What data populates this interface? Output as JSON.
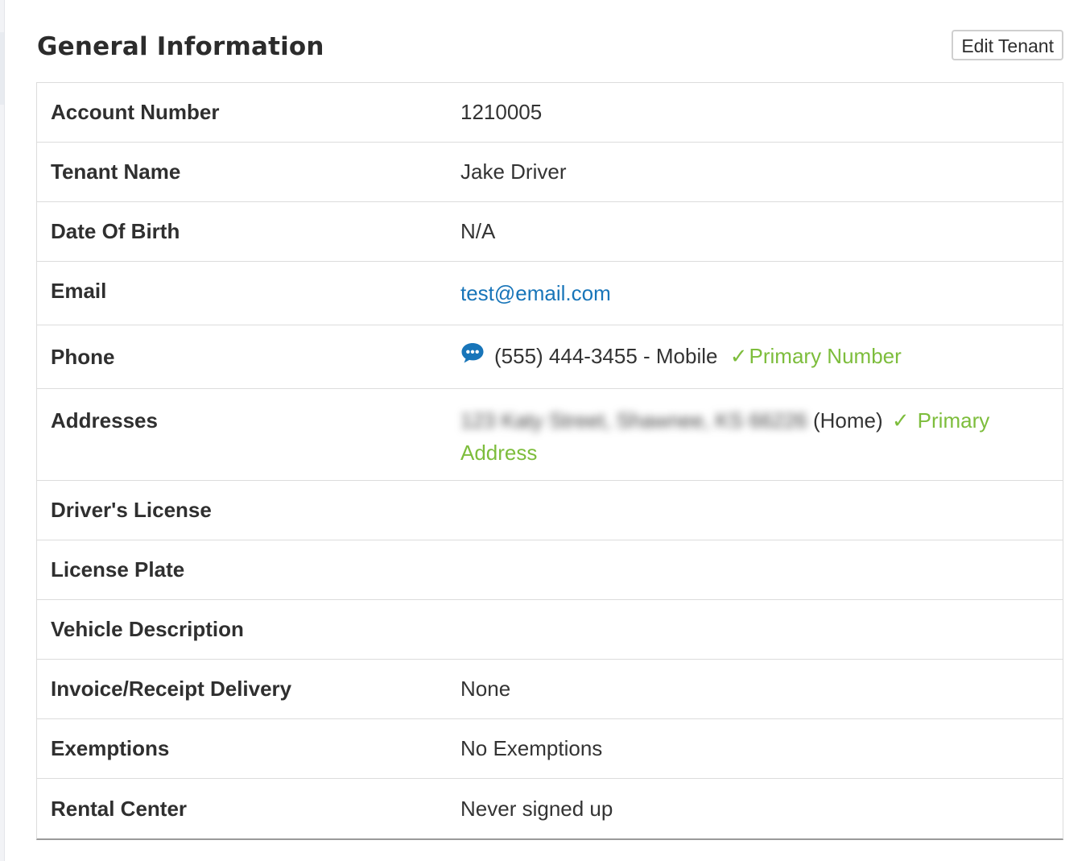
{
  "header": {
    "title": "General Information",
    "edit_button": "Edit Tenant"
  },
  "rows": [
    {
      "label": "Account Number",
      "value": "1210005"
    },
    {
      "label": "Tenant Name",
      "value": "Jake Driver"
    },
    {
      "label": "Date Of Birth",
      "value": "N/A"
    },
    {
      "label": "Email",
      "value": "test@email.com"
    },
    {
      "label": "Phone",
      "value": "(555) 444-3455 - Mobile",
      "badge": "Primary Number"
    },
    {
      "label": "Addresses",
      "value_blurred": "123 Katy Street, Shawnee, KS 66226",
      "value": " (Home) ",
      "badge": "Primary Address"
    },
    {
      "label": "Driver's License",
      "value": ""
    },
    {
      "label": "License Plate",
      "value": ""
    },
    {
      "label": "Vehicle Description",
      "value": ""
    },
    {
      "label": "Invoice/Receipt Delivery",
      "value": "None"
    },
    {
      "label": "Exemptions",
      "value": "No Exemptions"
    },
    {
      "label": "Rental Center",
      "value": "Never signed up"
    }
  ],
  "icons": {
    "sms": "chat-bubble-icon",
    "check": "checkmark-icon"
  },
  "colors": {
    "link": "#1875b9",
    "success": "#7dbd3c"
  }
}
